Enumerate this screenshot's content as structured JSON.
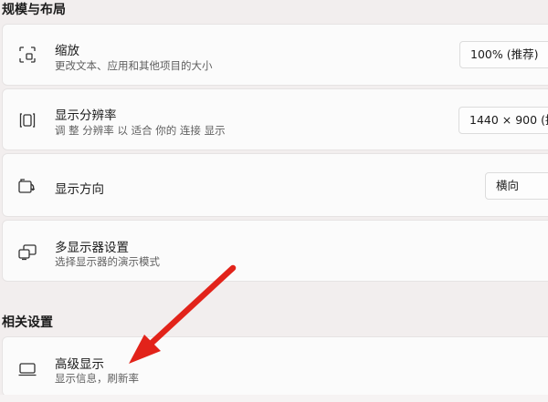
{
  "sections": {
    "scale_layout": "规模与布局",
    "related": "相关设置"
  },
  "cards": {
    "zoom": {
      "title": "缩放",
      "desc": "更改文本、应用和其他项目的大小",
      "value": "100% (推荐)"
    },
    "resolution": {
      "title": "显示分辨率",
      "desc": "调 整 分辨率 以 适合 你的 连接 显示",
      "value": "1440 × 900 (推"
    },
    "orientation": {
      "title": "显示方向",
      "value": "横向"
    },
    "multi_display": {
      "title": "多显示器设置",
      "desc": "选择显示器的演示模式"
    },
    "advanced_display": {
      "title": "高级显示",
      "desc": "显示信息，刷新率"
    }
  },
  "colors": {
    "arrow": "#e2231a",
    "background": "#f2eeee",
    "card": "#fbfbfb"
  },
  "icons": {
    "zoom": "zoom-frame-icon",
    "resolution": "resolution-brackets-icon",
    "orientation": "rotate-screen-icon",
    "multi_display": "multiple-monitors-icon",
    "advanced_display": "laptop-display-icon"
  }
}
